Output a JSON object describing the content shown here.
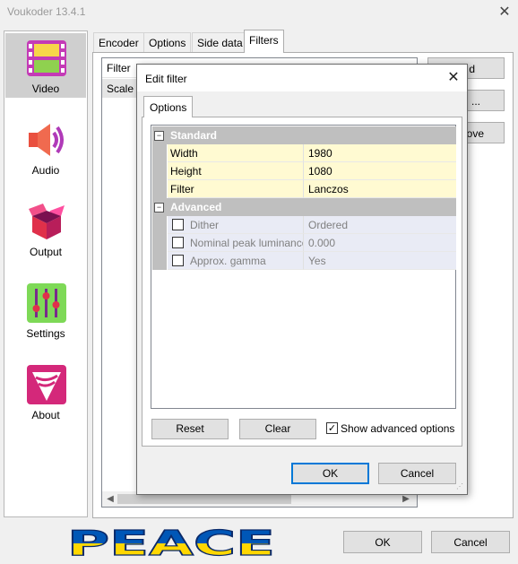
{
  "window": {
    "title": "Voukoder 13.4.1"
  },
  "sidebar": {
    "items": [
      {
        "label": "Video",
        "icon": "film-icon",
        "active": true
      },
      {
        "label": "Audio",
        "icon": "speaker-icon"
      },
      {
        "label": "Output",
        "icon": "box-icon"
      },
      {
        "label": "Settings",
        "icon": "sliders-icon"
      },
      {
        "label": "About",
        "icon": "voukoder-logo-icon"
      }
    ]
  },
  "tabs": [
    "Encoder",
    "Options",
    "Side data",
    "Filters"
  ],
  "active_tab": "Filters",
  "filters_panel": {
    "list_header": "Filter",
    "rows": [
      "Scale ("
    ],
    "buttons": {
      "add": "Add",
      "edit": "Edit ...",
      "remove": "Remove"
    },
    "add_visible": "d",
    "edit_visible": "...",
    "remove_visible": "ove"
  },
  "dialog": {
    "title": "Edit filter",
    "tab": "Options",
    "categories": [
      {
        "name": "Standard",
        "properties": [
          {
            "name": "Width",
            "value": "1980"
          },
          {
            "name": "Height",
            "value": "1080"
          },
          {
            "name": "Filter",
            "value": "Lanczos"
          }
        ]
      },
      {
        "name": "Advanced",
        "properties": [
          {
            "name": "Dither",
            "value": "Ordered",
            "checked": false
          },
          {
            "name": "Nominal peak luminance",
            "value": "0.000",
            "checked": false
          },
          {
            "name": "Approx. gamma",
            "value": "Yes",
            "checked": false
          }
        ]
      }
    ],
    "reset_label": "Reset",
    "clear_label": "Clear",
    "show_advanced_label": "Show advanced options",
    "show_advanced_checked": true,
    "ok_label": "OK",
    "cancel_label": "Cancel"
  },
  "footer": {
    "logo_text": "PEACE",
    "ok_label": "OK",
    "cancel_label": "Cancel"
  },
  "colors": {
    "standard_row": "#fffad2",
    "advanced_row": "#e9ebf5",
    "category_band": "#bfbfbf",
    "accent": "#0078d7",
    "peace_blue": "#0057b7",
    "peace_yellow": "#ffd700"
  }
}
